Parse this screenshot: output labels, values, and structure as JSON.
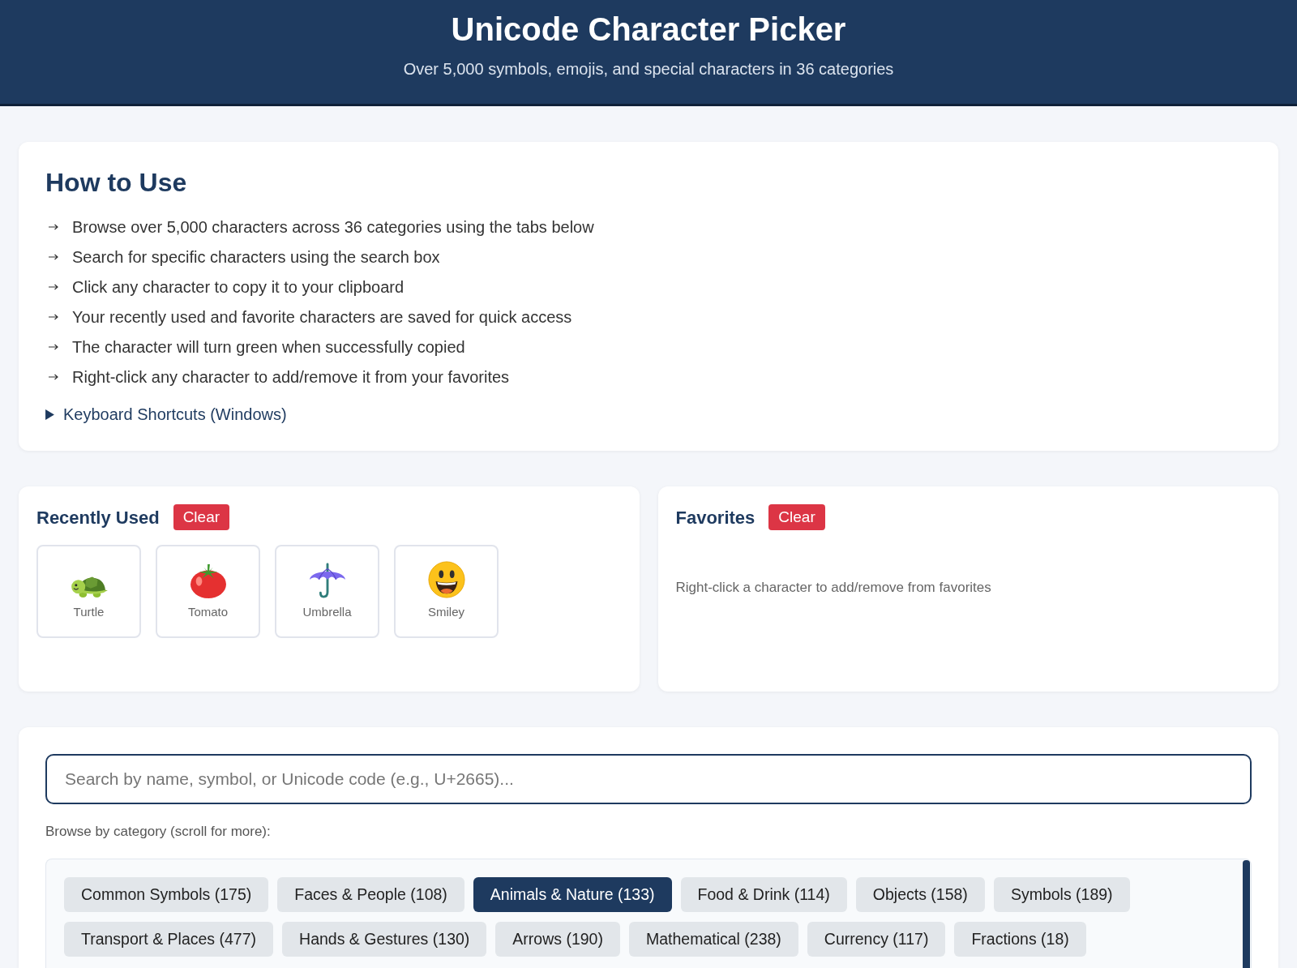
{
  "header": {
    "title": "Unicode Character Picker",
    "subtitle": "Over 5,000 symbols, emojis, and special characters in 36 categories"
  },
  "how_to_use": {
    "title": "How to Use",
    "items": [
      "Browse over 5,000 characters across 36 categories using the tabs below",
      "Search for specific characters using the search box",
      "Click any character to copy it to your clipboard",
      "Your recently used and favorite characters are saved for quick access",
      "The character will turn green when successfully copied",
      "Right-click any character to add/remove it from your favorites"
    ],
    "shortcuts": {
      "label": "Keyboard Shortcuts (Windows)",
      "expanded": false
    }
  },
  "recently_used": {
    "title": "Recently Used",
    "clear_button": "Clear",
    "items": [
      {
        "kind": "turtle",
        "name": "Turtle"
      },
      {
        "kind": "tomato",
        "name": "Tomato"
      },
      {
        "kind": "umbrella",
        "name": "Umbrella"
      },
      {
        "kind": "smiley",
        "name": "Smiley"
      }
    ]
  },
  "favorites": {
    "title": "Favorites",
    "clear_button": "Clear",
    "empty_message": "Right-click a character to add/remove from favorites"
  },
  "search": {
    "placeholder": "Search by name, symbol, or Unicode code (e.g., U+2665)..."
  },
  "categories": {
    "label": "Browse by category (scroll for more):",
    "tabs": [
      {
        "label": "Common Symbols (175)",
        "selected": false
      },
      {
        "label": "Faces & People (108)",
        "selected": false
      },
      {
        "label": "Animals & Nature (133)",
        "selected": true
      },
      {
        "label": "Food & Drink (114)",
        "selected": false
      },
      {
        "label": "Objects (158)",
        "selected": false
      },
      {
        "label": "Symbols (189)",
        "selected": false
      },
      {
        "label": "Transport & Places (477)",
        "selected": false
      },
      {
        "label": "Hands & Gestures (130)",
        "selected": false
      },
      {
        "label": "Arrows (190)",
        "selected": false
      },
      {
        "label": "Mathematical (238)",
        "selected": false
      },
      {
        "label": "Currency (117)",
        "selected": false
      },
      {
        "label": "Fractions (18)",
        "selected": false
      }
    ]
  }
}
